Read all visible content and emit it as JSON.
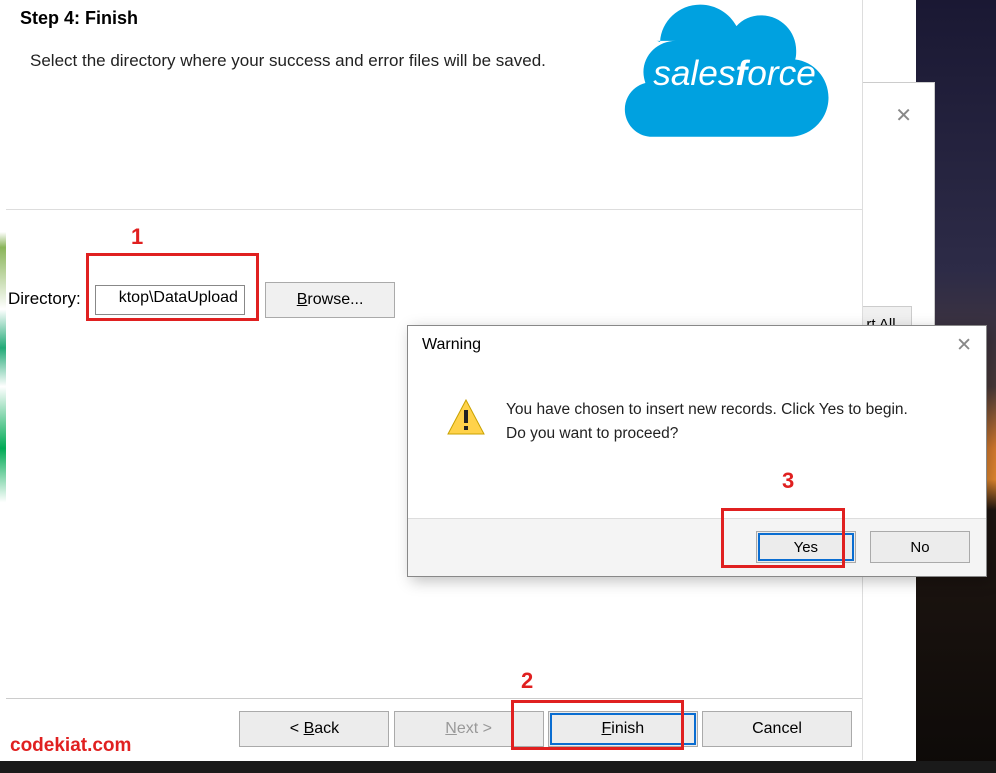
{
  "wizard": {
    "step_title": "Step 4: Finish",
    "step_desc": "Select the directory where your success and error files will be saved.",
    "directory_label": "Directory:",
    "directory_value": "ktop\\DataUpload",
    "browse_label_pre": "B",
    "browse_label_rest": "rowse...",
    "logo_text": "salesforce"
  },
  "footer": {
    "back_pre": "< ",
    "back_u": "B",
    "back_rest": "ack",
    "next_u": "N",
    "next_rest": "ext >",
    "finish_u": "F",
    "finish_rest": "inish",
    "cancel": "Cancel"
  },
  "secondary": {
    "export_all": "rt All"
  },
  "dialog": {
    "title": "Warning",
    "message_line1": "You have chosen to insert new records.  Click Yes to begin.",
    "message_line2": "Do you want to proceed?",
    "yes": "Yes",
    "no": "No"
  },
  "annotations": {
    "n1": "1",
    "n2": "2",
    "n3": "3",
    "watermark": "codekiat.com"
  }
}
